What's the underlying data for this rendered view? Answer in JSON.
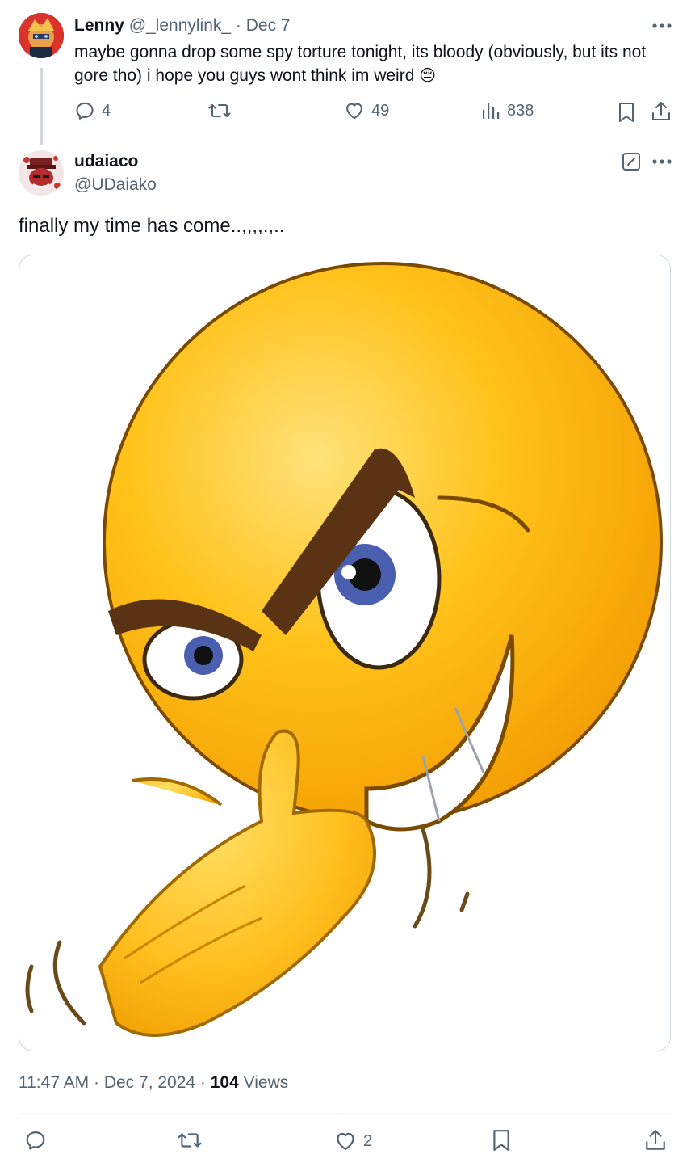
{
  "parent_tweet": {
    "name": "Lenny",
    "handle": "@_lennylink_",
    "date": "· Dec 7",
    "text": "maybe gonna drop some spy torture tonight, its bloody (obviously, but its not gore tho) i hope you guys wont think im weird",
    "emoji": "😔",
    "replies": "4",
    "likes": "49",
    "views": "838"
  },
  "main_tweet": {
    "name": "udaiaco",
    "handle": "@UDaiako",
    "text": "finally my time has come..,,,,.,..",
    "timestamp": "11:47 AM · Dec 7, 2024 · ",
    "views_count": "104",
    "views_label": " Views",
    "likes": "2"
  },
  "icons": [
    "more-icon",
    "reply-icon",
    "retweet-icon",
    "like-icon",
    "views-icon",
    "bookmark-icon",
    "share-icon",
    "edit-icon"
  ],
  "colors": {
    "text": "#0f1419",
    "muted": "#536471",
    "border": "#cfd9de",
    "emoji_yellow": "#f7b500"
  }
}
